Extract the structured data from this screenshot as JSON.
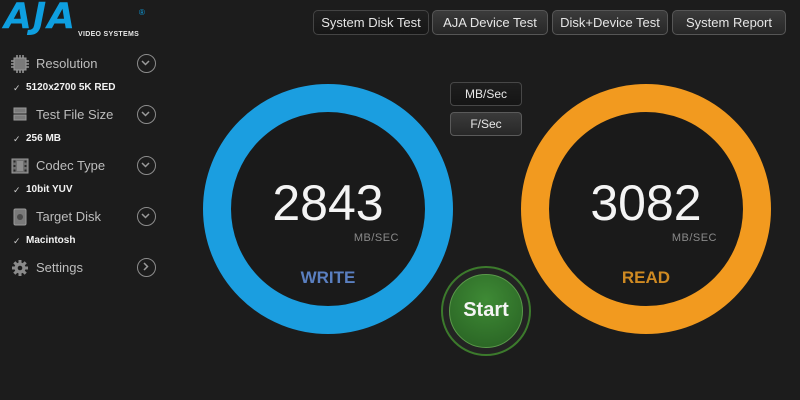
{
  "logo": {
    "word": "AJA",
    "registered": "®",
    "subtitle": "VIDEO SYSTEMS"
  },
  "tabs": [
    {
      "label": "System Disk Test",
      "active": true
    },
    {
      "label": "AJA Device Test"
    },
    {
      "label": "Disk+Device Test"
    },
    {
      "label": "System Report"
    }
  ],
  "sidebar": {
    "resolution": {
      "label": "Resolution",
      "value": "5120x2700 5K RED",
      "icon": "resolution-icon"
    },
    "file_size": {
      "label": "Test File Size",
      "value": "256 MB",
      "icon": "file-size-icon"
    },
    "codec": {
      "label": "Codec Type",
      "value": "10bit YUV",
      "icon": "film-icon"
    },
    "target_disk": {
      "label": "Target Disk",
      "value": "Macintosh",
      "icon": "disk-icon"
    },
    "settings": {
      "label": "Settings",
      "icon": "gear-icon"
    }
  },
  "units": {
    "mbsec": "MB/Sec",
    "fsec": "F/Sec",
    "selected": "MB/Sec"
  },
  "write": {
    "value": "2843",
    "unit": "MB/SEC",
    "label": "WRITE",
    "color": "#1b9ee0"
  },
  "read": {
    "value": "3082",
    "unit": "MB/SEC",
    "label": "READ",
    "color": "#f29a1f"
  },
  "start": {
    "label": "Start",
    "color": "#2f7a2a"
  },
  "check_mark": "✓"
}
